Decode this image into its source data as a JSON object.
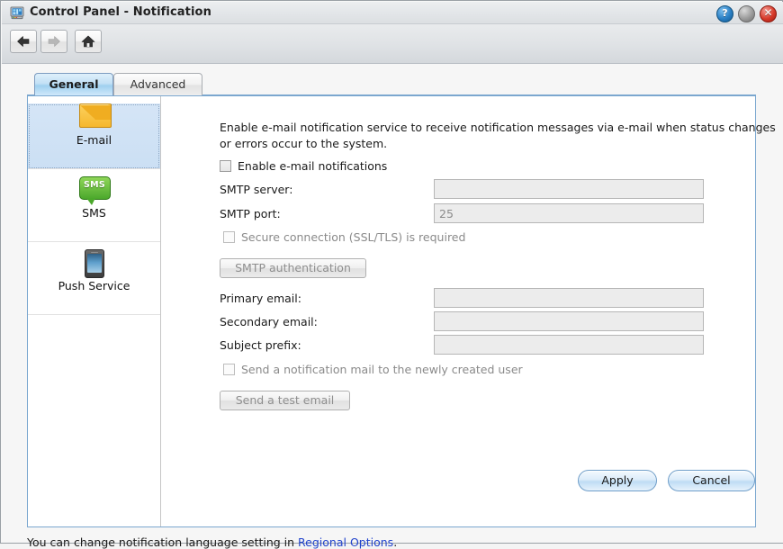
{
  "window": {
    "title": "Control Panel - Notification",
    "icon": "control-panel-icon",
    "buttons": {
      "help": "?",
      "minimize": "",
      "close": "✕"
    }
  },
  "toolbar": {
    "back": "back-arrow-icon",
    "forward": "forward-arrow-icon",
    "home": "home-icon"
  },
  "tabs": [
    {
      "label": "General",
      "active": true
    },
    {
      "label": "Advanced",
      "active": false
    }
  ],
  "sidebar": {
    "items": [
      {
        "label": "E-mail",
        "icon": "envelope-icon",
        "selected": true
      },
      {
        "label": "SMS",
        "icon": "sms-bubble-icon",
        "badge": "SMS",
        "selected": false
      },
      {
        "label": "Push Service",
        "icon": "mobile-phone-icon",
        "selected": false
      }
    ]
  },
  "main": {
    "intro": "Enable e-mail notification service to receive notification messages via e-mail when status changes or errors occur to the system.",
    "enable_checkbox": {
      "label": "Enable e-mail notifications",
      "checked": false,
      "disabled": false
    },
    "fields": [
      {
        "label": "SMTP server:",
        "value": "",
        "placeholder": "",
        "disabled": true
      },
      {
        "label": "SMTP port:",
        "value": "25",
        "placeholder": "",
        "disabled": true
      }
    ],
    "secure_checkbox": {
      "label": "Secure connection (SSL/TLS) is required",
      "checked": false,
      "disabled": true
    },
    "smtp_auth_button": {
      "label": "SMTP authentication",
      "disabled": true
    },
    "email_fields": [
      {
        "label": "Primary email:",
        "value": "",
        "disabled": true
      },
      {
        "label": "Secondary email:",
        "value": "",
        "disabled": true
      },
      {
        "label": "Subject prefix:",
        "value": "",
        "disabled": true
      }
    ],
    "notify_checkbox": {
      "label": "Send a notification mail to the newly created user",
      "checked": false,
      "disabled": true
    },
    "test_email_button": {
      "label": "Send a test email",
      "disabled": true
    },
    "apply_button": "Apply",
    "cancel_button": "Cancel"
  },
  "footer": {
    "text_before": "You can change notification language setting in ",
    "link": "Regional Options",
    "text_after": "."
  },
  "colors": {
    "accent": "#7ba7cf",
    "link": "#2244cc",
    "tab_active": "#9fd0ef",
    "selected_row": "#cbdff4"
  }
}
